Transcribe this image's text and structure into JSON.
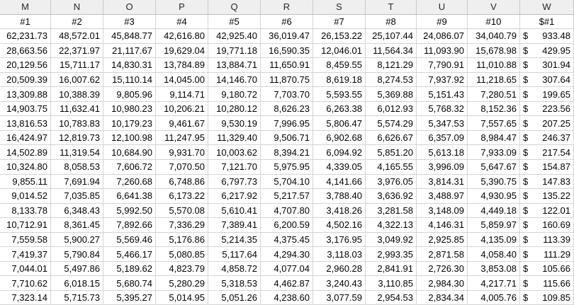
{
  "columns": [
    "M",
    "N",
    "O",
    "P",
    "Q",
    "R",
    "S",
    "T",
    "U",
    "V",
    "W"
  ],
  "headers": [
    "#1",
    "#2",
    "#3",
    "#4",
    "#5",
    "#6",
    "#7",
    "#8",
    "#9",
    "#10",
    "$#1"
  ],
  "currency_symbol": "$",
  "rows": [
    [
      "62,231.73",
      "48,572.01",
      "45,848.77",
      "42,616.80",
      "42,925.40",
      "36,019.47",
      "26,153.22",
      "25,107.44",
      "24,086.07",
      "34,040.79",
      "933.48"
    ],
    [
      "28,663.56",
      "22,371.97",
      "21,117.67",
      "19,629.04",
      "19,771.18",
      "16,590.35",
      "12,046.01",
      "11,564.34",
      "11,093.90",
      "15,678.98",
      "429.95"
    ],
    [
      "20,129.56",
      "15,711.17",
      "14,830.31",
      "13,784.89",
      "13,884.71",
      "11,650.91",
      "8,459.55",
      "8,121.29",
      "7,790.91",
      "11,010.88",
      "301.94"
    ],
    [
      "20,509.39",
      "16,007.62",
      "15,110.14",
      "14,045.00",
      "14,146.70",
      "11,870.75",
      "8,619.18",
      "8,274.53",
      "7,937.92",
      "11,218.65",
      "307.64"
    ],
    [
      "13,309.88",
      "10,388.39",
      "9,805.96",
      "9,114.71",
      "9,180.72",
      "7,703.70",
      "5,593.55",
      "5,369.88",
      "5,151.43",
      "7,280.51",
      "199.65"
    ],
    [
      "14,903.75",
      "11,632.41",
      "10,980.23",
      "10,206.21",
      "10,280.12",
      "8,626.23",
      "6,263.38",
      "6,012.93",
      "5,768.32",
      "8,152.36",
      "223.56"
    ],
    [
      "13,816.53",
      "10,783.83",
      "10,179.23",
      "9,461.67",
      "9,530.19",
      "7,996.95",
      "5,806.47",
      "5,574.29",
      "5,347.53",
      "7,557.65",
      "207.25"
    ],
    [
      "16,424.97",
      "12,819.73",
      "12,100.98",
      "11,247.95",
      "11,329.40",
      "9,506.71",
      "6,902.68",
      "6,626.67",
      "6,357.09",
      "8,984.47",
      "246.37"
    ],
    [
      "14,502.89",
      "11,319.54",
      "10,684.90",
      "9,931.70",
      "10,003.62",
      "8,394.21",
      "6,094.92",
      "5,851.20",
      "5,613.18",
      "7,933.09",
      "217.54"
    ],
    [
      "10,324.80",
      "8,058.53",
      "7,606.72",
      "7,070.50",
      "7,121.70",
      "5,975.95",
      "4,339.05",
      "4,165.55",
      "3,996.09",
      "5,647.67",
      "154.87"
    ],
    [
      "9,855.11",
      "7,691.94",
      "7,260.68",
      "6,748.86",
      "6,797.73",
      "5,704.10",
      "4,141.66",
      "3,976.05",
      "3,814.31",
      "5,390.75",
      "147.83"
    ],
    [
      "9,014.52",
      "7,035.85",
      "6,641.38",
      "6,173.22",
      "6,217.92",
      "5,217.57",
      "3,788.40",
      "3,636.92",
      "3,488.97",
      "4,930.95",
      "135.22"
    ],
    [
      "8,133.78",
      "6,348.43",
      "5,992.50",
      "5,570.08",
      "5,610.41",
      "4,707.80",
      "3,418.26",
      "3,281.58",
      "3,148.09",
      "4,449.18",
      "122.01"
    ],
    [
      "10,712.91",
      "8,361.45",
      "7,892.66",
      "7,336.29",
      "7,389.41",
      "6,200.59",
      "4,502.16",
      "4,322.13",
      "4,146.31",
      "5,859.97",
      "160.69"
    ],
    [
      "7,559.58",
      "5,900.27",
      "5,569.46",
      "5,176.86",
      "5,214.35",
      "4,375.45",
      "3,176.95",
      "3,049.92",
      "2,925.85",
      "4,135.09",
      "113.39"
    ],
    [
      "7,419.37",
      "5,790.84",
      "5,466.17",
      "5,080.85",
      "5,117.64",
      "4,294.30",
      "3,118.03",
      "2,993.35",
      "2,871.58",
      "4,058.40",
      "111.29"
    ],
    [
      "7,044.01",
      "5,497.86",
      "5,189.62",
      "4,823.79",
      "4,858.72",
      "4,077.04",
      "2,960.28",
      "2,841.91",
      "2,726.30",
      "3,853.08",
      "105.66"
    ],
    [
      "7,710.62",
      "6,018.15",
      "5,680.74",
      "5,280.29",
      "5,318.53",
      "4,462.87",
      "3,240.43",
      "3,110.85",
      "2,984.30",
      "4,217.71",
      "115.66"
    ],
    [
      "7,323.14",
      "5,715.73",
      "5,395.27",
      "5,014.95",
      "5,051.26",
      "4,238.60",
      "3,077.59",
      "2,954.53",
      "2,834.34",
      "4,005.76",
      "109.85"
    ]
  ]
}
